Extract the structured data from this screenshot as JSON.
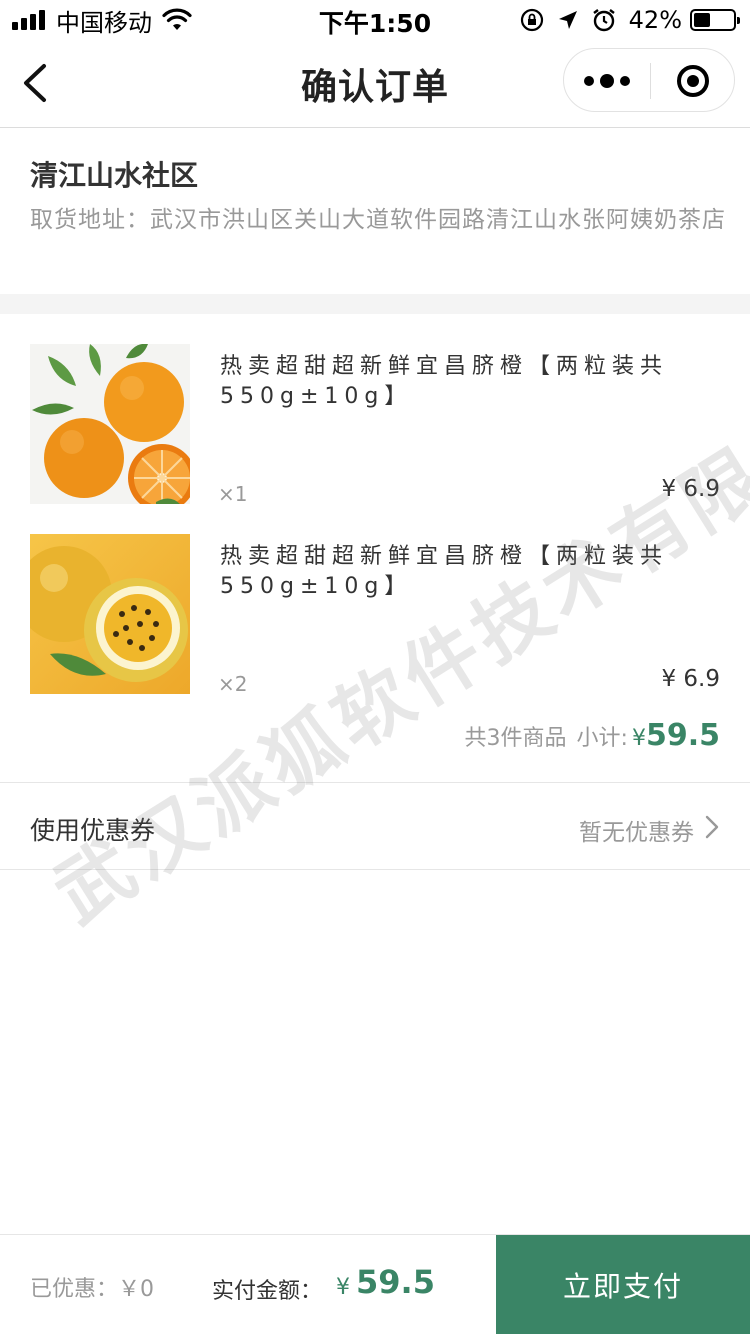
{
  "status_bar": {
    "carrier": "中国移动",
    "time": "下午1:50",
    "battery": "42%",
    "battery_level": 0.42,
    "icons": [
      "signal-icon",
      "wifi-icon",
      "rotation-lock-icon",
      "location-icon",
      "alarm-icon",
      "battery-icon"
    ]
  },
  "nav": {
    "title": "确认订单",
    "icons": [
      "back-icon",
      "more-icon",
      "close-mini-program-icon"
    ]
  },
  "pickup": {
    "community": "清江山水社区",
    "address": "取货地址：武汉市洪山区关山大道软件园路清江山水张阿姨奶茶店"
  },
  "products": [
    {
      "name": "热卖超甜超新鲜宜昌脐橙【两粒装共550g±10g】",
      "quantity": "×1",
      "price": "¥ 6.9",
      "image": "orange-image"
    },
    {
      "name": "热卖超甜超新鲜宜昌脐橙【两粒装共550g±10g】",
      "quantity": "×2",
      "price": "¥ 6.9",
      "image": "passion-fruit-image"
    }
  ],
  "subtotal": {
    "count": "共3件商品",
    "label": "小计:",
    "currency": "¥",
    "amount": "59.5"
  },
  "coupon": {
    "label": "使用优惠券",
    "value": "暂无优惠券"
  },
  "watermark": "武汉派狐软件技术有限公司",
  "footer": {
    "discount": "已优惠：￥0",
    "payable_label": "实付金额：",
    "currency": "¥",
    "amount": "59.5",
    "pay_button": "立即支付"
  },
  "colors": {
    "accent": "#3a8566",
    "muted": "#999999",
    "divider": "#e6e6e6"
  }
}
